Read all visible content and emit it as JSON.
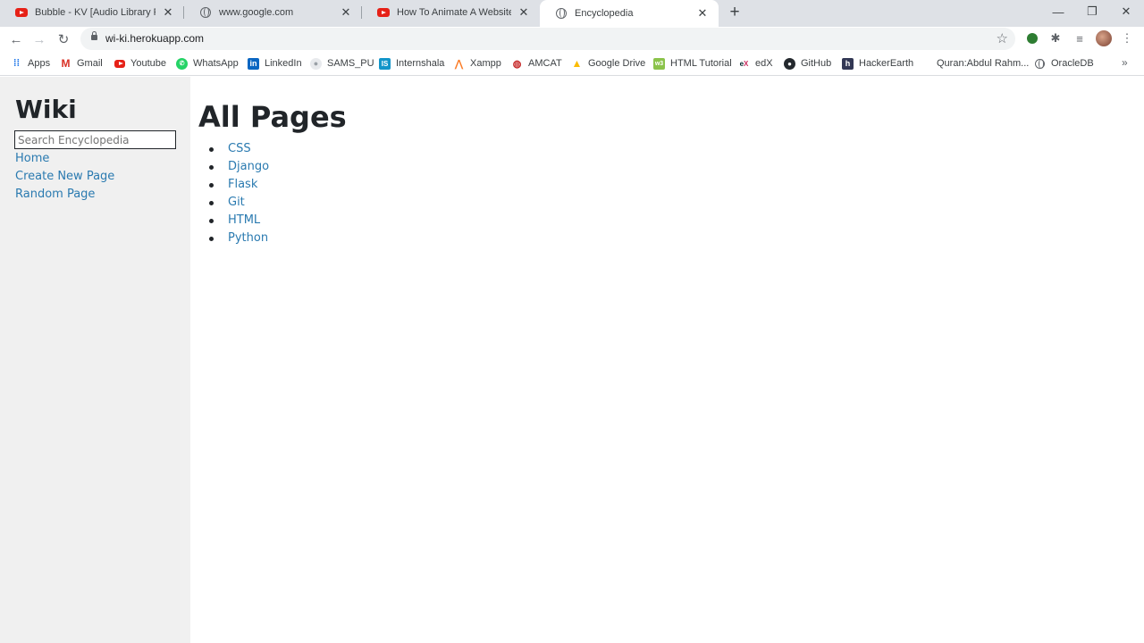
{
  "browser": {
    "tabs": [
      {
        "title": "Bubble - KV [Audio Library Release]",
        "icon": "youtube-icon",
        "active": false
      },
      {
        "title": "www.google.com",
        "icon": "globe-icon",
        "active": false
      },
      {
        "title": "How To Animate A Website In After Effects",
        "icon": "youtube-icon",
        "active": false
      },
      {
        "title": "Encyclopedia",
        "icon": "globe-icon",
        "active": true
      }
    ],
    "url": "wi-ki.herokuapp.com"
  },
  "bookmarks": [
    {
      "label": "Apps",
      "icon": "apps-grid-icon"
    },
    {
      "label": "Gmail",
      "icon": "gmail-icon"
    },
    {
      "label": "Youtube",
      "icon": "youtube-icon"
    },
    {
      "label": "WhatsApp",
      "icon": "whatsapp-icon"
    },
    {
      "label": "LinkedIn",
      "icon": "linkedin-icon"
    },
    {
      "label": "SAMS_PU",
      "icon": "sams-icon"
    },
    {
      "label": "Internshala",
      "icon": "internshala-icon"
    },
    {
      "label": "Xampp",
      "icon": "xampp-icon"
    },
    {
      "label": "AMCAT",
      "icon": "amcat-icon"
    },
    {
      "label": "Google Drive",
      "icon": "google-drive-icon"
    },
    {
      "label": "HTML Tutorial",
      "icon": "w3schools-icon"
    },
    {
      "label": "edX",
      "icon": "edx-icon"
    },
    {
      "label": "GitHub",
      "icon": "github-icon"
    },
    {
      "label": "HackerEarth",
      "icon": "hackerearth-icon"
    },
    {
      "label": "Quran:Abdul Rahm...",
      "icon": "blank-icon"
    },
    {
      "label": "OracleDB",
      "icon": "globe-icon"
    }
  ],
  "sidebar": {
    "title": "Wiki",
    "search_placeholder": "Search Encyclopedia",
    "links": [
      "Home",
      "Create New Page",
      "Random Page"
    ]
  },
  "main": {
    "title": "All Pages",
    "entries": [
      "CSS",
      "Django",
      "Flask",
      "Git",
      "HTML",
      "Python"
    ]
  },
  "colors": {
    "link": "#2a7ab0",
    "sidebar_bg": "#f0f0f0",
    "tabstrip_bg": "#dee1e6"
  }
}
